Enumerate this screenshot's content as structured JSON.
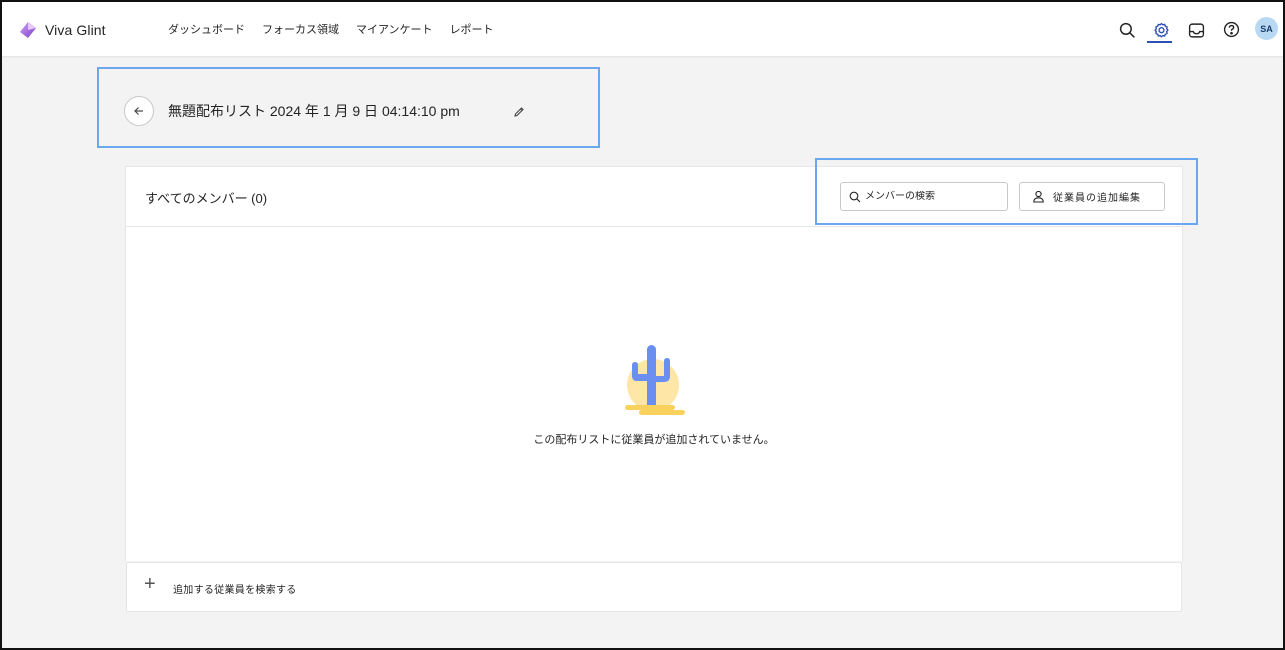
{
  "app": {
    "name": "Viva Glint"
  },
  "nav": {
    "items": [
      "ダッシュボード",
      "フォーカス領域",
      "マイアンケート",
      "レポート"
    ]
  },
  "toolbar": {
    "icons": [
      "search-icon",
      "settings-icon",
      "inbox-icon",
      "help-icon"
    ],
    "active_icon": "settings-icon",
    "avatar_initials": "SA"
  },
  "page": {
    "title": "無題配布リスト 2024 年 1 月 9 日 04:14:10 pm"
  },
  "members": {
    "title": "すべてのメンバー (0)",
    "search_placeholder": "メンバーの検索",
    "edit_button_label": "従業員の追加編集",
    "empty_message": "この配布リストに従業員が追加されていません。"
  },
  "add_bar": {
    "label": "追加する従業員を検索する"
  },
  "colors": {
    "accent": "#2b4fb5",
    "highlight": "#6aa7ee",
    "cactus": "#6b8ff0",
    "sun": "#fde6a6",
    "sand": "#f8d25c"
  }
}
